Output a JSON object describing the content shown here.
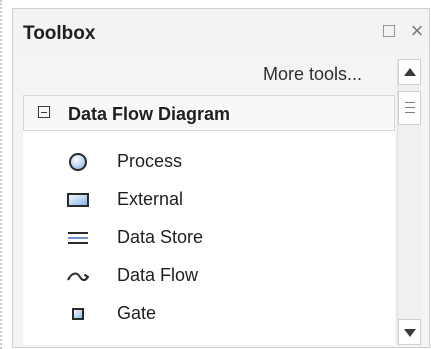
{
  "toolbox": {
    "title": "Toolbox",
    "more_tools_label": "More tools...",
    "group": {
      "label": "Data Flow Diagram",
      "expanded": true
    },
    "items": [
      {
        "label": "Process",
        "icon": "process-icon"
      },
      {
        "label": "External",
        "icon": "external-icon"
      },
      {
        "label": "Data Store",
        "icon": "data-store-icon"
      },
      {
        "label": "Data Flow",
        "icon": "data-flow-icon"
      },
      {
        "label": "Gate",
        "icon": "gate-icon"
      }
    ]
  },
  "window_controls": {
    "maximize_icon": "maximize-icon",
    "close_icon": "close-icon"
  },
  "colors": {
    "accent_blue": "#2a6fbe",
    "panel_bg": "#f4f4f4",
    "border": "#cfcfcf"
  }
}
